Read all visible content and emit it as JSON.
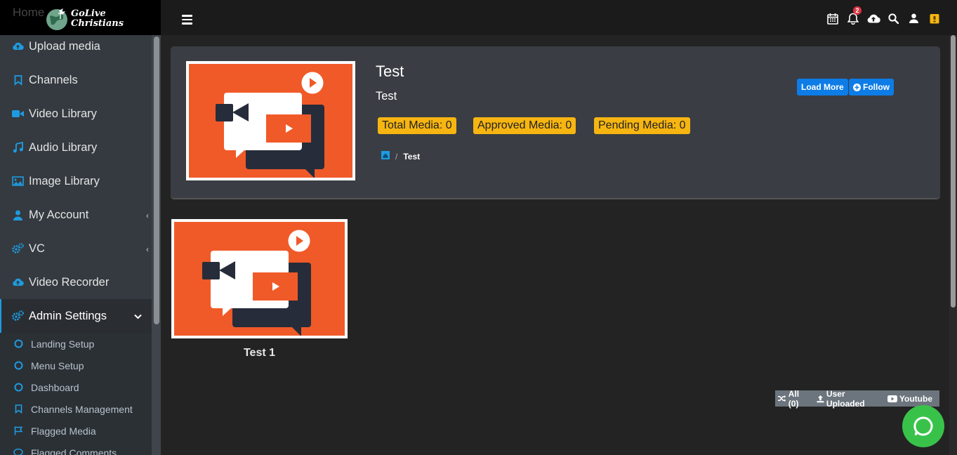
{
  "brand": {
    "line1": "GoLive",
    "line2": "Christians",
    "ghost_home": "Home"
  },
  "sidebar": {
    "items": [
      {
        "label": "Upload media",
        "icon": "cloud-upload-icon"
      },
      {
        "label": "Channels",
        "icon": "bookmark-icon"
      },
      {
        "label": "Video Library",
        "icon": "video-camera-icon"
      },
      {
        "label": "Audio Library",
        "icon": "music-note-icon"
      },
      {
        "label": "Image Library",
        "icon": "image-icon"
      },
      {
        "label": "My Account",
        "icon": "user-icon",
        "caret": "‹"
      },
      {
        "label": "VC",
        "icon": "cogs-icon",
        "caret": "‹"
      },
      {
        "label": "Video Recorder",
        "icon": "cloud-upload-icon"
      },
      {
        "label": "Admin Settings",
        "icon": "cogs-icon",
        "caret": "⌄",
        "active": true
      }
    ],
    "sub_items": [
      {
        "label": "Landing Setup",
        "icon": "circle-icon"
      },
      {
        "label": "Menu Setup",
        "icon": "circle-icon"
      },
      {
        "label": "Dashboard",
        "icon": "circle-icon"
      },
      {
        "label": "Channels Management",
        "icon": "bookmark-icon"
      },
      {
        "label": "Flagged Media",
        "icon": "flag-icon"
      },
      {
        "label": "Flagged Comments",
        "icon": "comment-icon"
      }
    ]
  },
  "topbar": {
    "notification_count": "2"
  },
  "channel": {
    "title": "Test",
    "subtitle": "Test",
    "stats": {
      "total": "Total Media: 0",
      "approved": "Approved Media: 0",
      "pending": "Pending Media: 0"
    },
    "breadcrumb": {
      "current": "Test",
      "separator": "/"
    },
    "load_more_label": "Load More",
    "follow_label": "Follow"
  },
  "videos": [
    {
      "title": "Test 1"
    }
  ],
  "filters": {
    "all": "All (0)",
    "user_uploaded": "User Uploaded",
    "youtube": "Youtube"
  },
  "colors": {
    "accent": "#1e9be0",
    "badge": "#f6b511",
    "thumb_bg": "#f05a28",
    "button": "#0d7ce6",
    "chat": "#39c24a"
  }
}
